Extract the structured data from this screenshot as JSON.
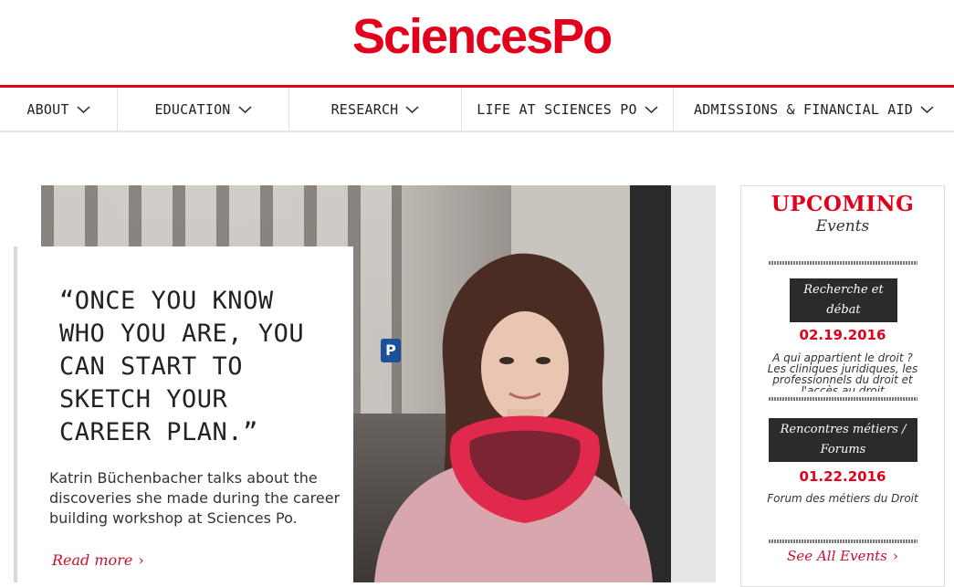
{
  "brand": {
    "logo_text": "SciencesPo",
    "accent": "#e2001a"
  },
  "nav": {
    "items": [
      {
        "label": "ABOUT"
      },
      {
        "label": "EDUCATION"
      },
      {
        "label": "RESEARCH"
      },
      {
        "label": "LIFE AT SCIENCES PO"
      },
      {
        "label": "ADMISSIONS & FINANCIAL AID"
      }
    ],
    "chevron_icon": "chevron-down-icon"
  },
  "feature": {
    "quote": "“ONCE YOU KNOW WHO YOU ARE, YOU CAN START TO SKETCH YOUR CAREER PLAN.”",
    "description": "Katrin Büchenbacher talks about the discoveries she made during the career building workshop at Sciences Po.",
    "read_more": "Read more",
    "arrow_icon": "chevron-right-icon"
  },
  "events": {
    "heading": "UPCOMING",
    "subheading": "Events",
    "items": [
      {
        "category": "Recherche et débat",
        "date": "02.19.2016",
        "title": "A qui appartient le droit ? Les cliniques juridiques, les professionnels du droit et l'accès au droit"
      },
      {
        "category": "Rencontres métiers / Forums",
        "date": "01.22.2016",
        "title": "Forum des métiers du Droit"
      }
    ],
    "see_all": "See All Events"
  }
}
